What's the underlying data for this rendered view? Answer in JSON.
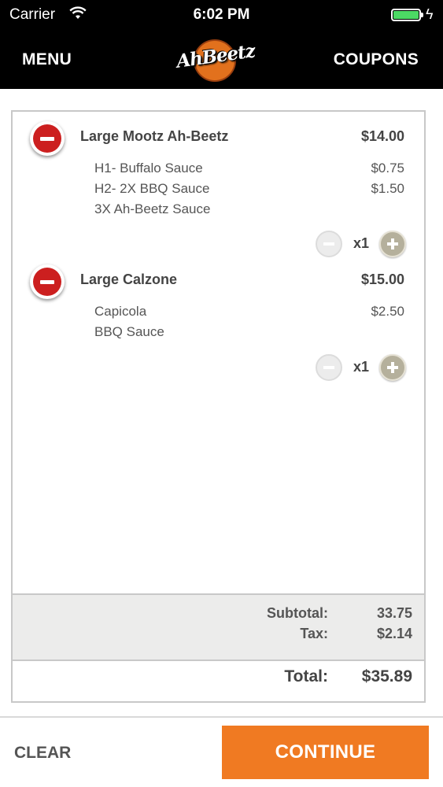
{
  "status_bar": {
    "carrier": "Carrier",
    "time": "6:02 PM"
  },
  "header": {
    "menu_label": "MENU",
    "coupons_label": "COUPONS",
    "logo_text": "AhBeetz"
  },
  "cart": {
    "items": [
      {
        "name": "Large  Mootz Ah-Beetz",
        "price": "$14.00",
        "modifiers": [
          {
            "name": "H1- Buffalo Sauce",
            "price": "$0.75"
          },
          {
            "name": "H2- 2X BBQ Sauce",
            "price": "$1.50"
          },
          {
            "name": "3X Ah-Beetz Sauce",
            "price": ""
          }
        ],
        "quantity": "x1"
      },
      {
        "name": "Large  Calzone",
        "price": "$15.00",
        "modifiers": [
          {
            "name": "Capicola",
            "price": "$2.50"
          },
          {
            "name": "BBQ Sauce",
            "price": ""
          }
        ],
        "quantity": "x1"
      }
    ],
    "subtotal_label": "Subtotal:",
    "subtotal_value": "33.75",
    "tax_label": "Tax:",
    "tax_value": "$2.14",
    "total_label": "Total:",
    "total_value": "$35.89"
  },
  "footer": {
    "clear_label": "CLEAR",
    "continue_label": "CONTINUE"
  },
  "colors": {
    "accent": "#f07a22",
    "remove": "#cc1f1f",
    "header_bg": "#000000",
    "totals_bg": "#ececeb"
  },
  "icons": [
    "wifi-icon",
    "battery-icon",
    "remove-item-icon",
    "minus-icon",
    "plus-icon"
  ]
}
